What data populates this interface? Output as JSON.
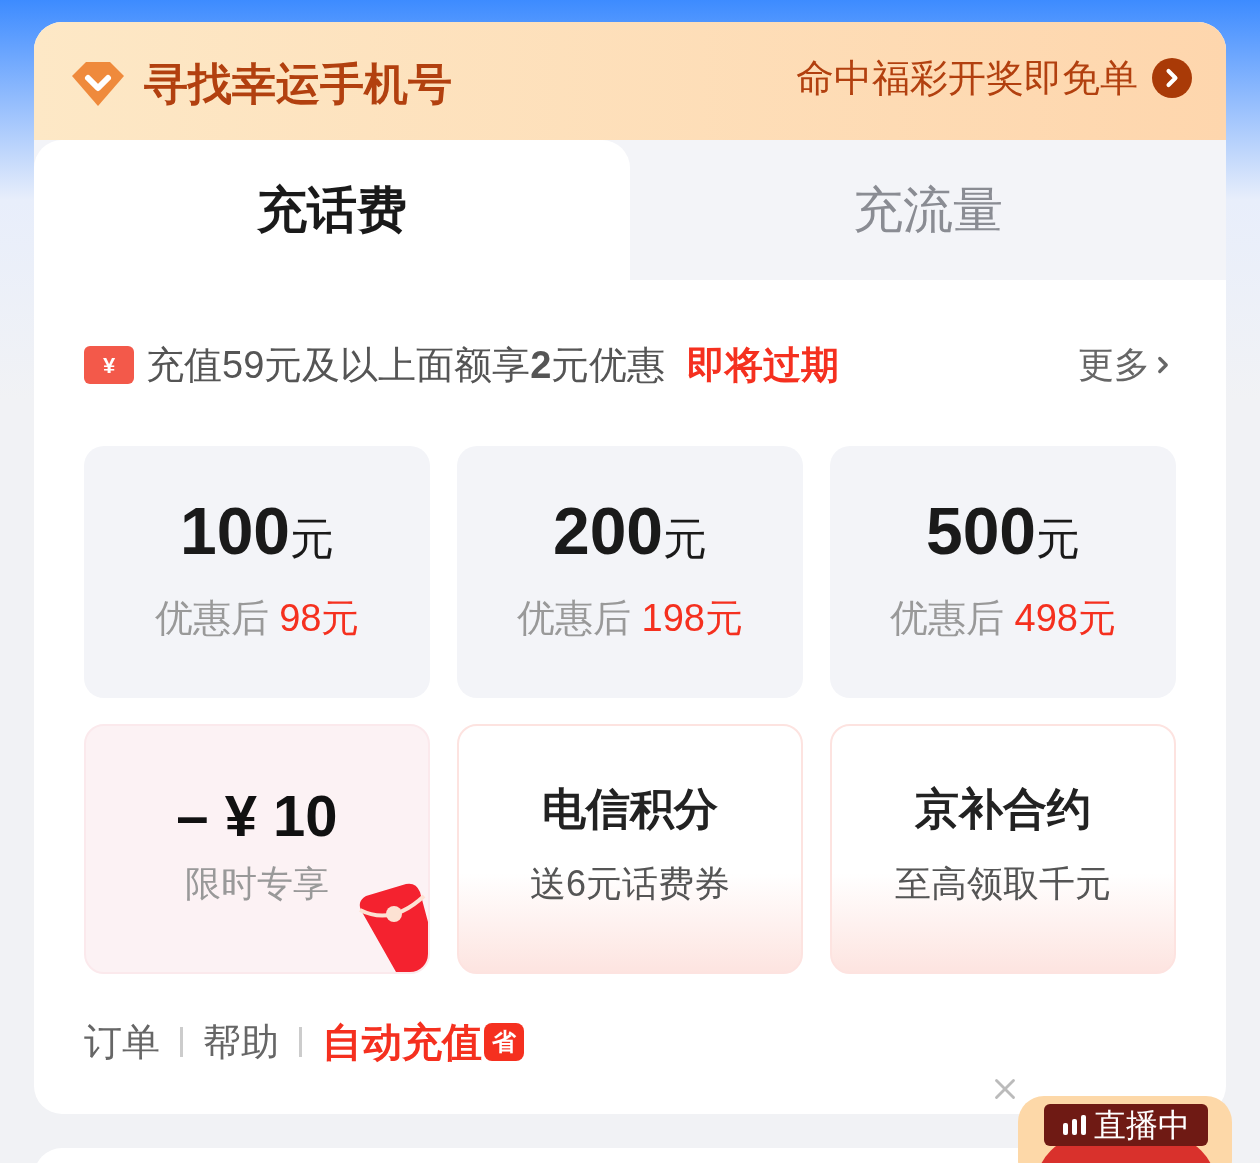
{
  "header": {
    "title": "寻找幸运手机号",
    "link": "命中福彩开奖即免单"
  },
  "tabs": [
    {
      "label": "充话费",
      "selected": true
    },
    {
      "label": "充流量",
      "selected": false
    }
  ],
  "coupon": {
    "icon_text": "¥",
    "text": "充值59元及以上面额享**2**元优惠",
    "status": "即将过期",
    "more": "更多"
  },
  "amounts": [
    {
      "value": "100",
      "unit": "元",
      "prefix": "优惠后",
      "price": "98元"
    },
    {
      "value": "200",
      "unit": "元",
      "prefix": "优惠后",
      "price": "198元"
    },
    {
      "value": "500",
      "unit": "元",
      "prefix": "优惠后",
      "price": "498元"
    }
  ],
  "promos": [
    {
      "kind": "discount",
      "title": "– ¥ 10",
      "subtitle": "限时专享"
    },
    {
      "kind": "offer",
      "title": "电信积分",
      "subtitle": "送6元话费券"
    },
    {
      "kind": "offer",
      "title": "京补合约",
      "subtitle": "至高领取千元"
    }
  ],
  "footer": {
    "links": [
      "订单",
      "帮助"
    ],
    "auto": {
      "label": "自动充值",
      "badge": "省"
    }
  },
  "live": {
    "label": "直播中"
  }
}
